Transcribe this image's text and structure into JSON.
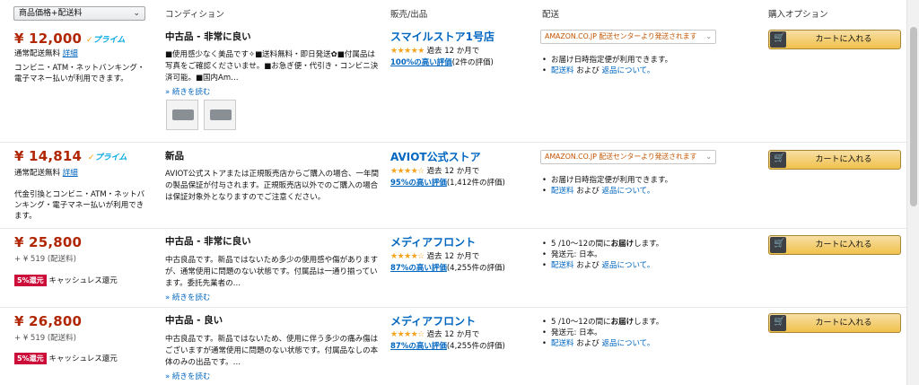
{
  "header": {
    "sort_value": "商品価格+配送料",
    "col_condition": "コンディション",
    "col_seller": "販売/出品",
    "col_shipping": "配送",
    "col_purchase": "購入オプション"
  },
  "offers": [
    {
      "price": "¥ 12,000",
      "prime": "プライム",
      "free_shipping": "通常配送無料",
      "details_link": "詳細",
      "payment": "コンビニ・ATM・ネットバンキング・電子マネー払いが利用できます。",
      "condition": "中古品 - 非常に良い",
      "desc": "■使用感少なく美品です✧■送料無料・即日発送✿■付属品は写真をご確認くださいませ。■お急ぎ便・代引き・コンビニ決済可能。■国内Am…",
      "read_more": "» 続きを読む",
      "seller": "スマイルストア1号店",
      "stars": "★★★★★",
      "period": "過去 12 か月で",
      "positive": "100%の高い評価",
      "count": "(2件の評価)",
      "ship_select": "AMAZON.CO.JP 配送センターより発送されます",
      "ship_1": "お届け日時指定便が利用できます。",
      "ship_fee": "配送料",
      "ship_and": "および",
      "ship_return": "返品について。",
      "cart": "カートに入れる"
    },
    {
      "price": "¥ 14,814",
      "prime": "プライム",
      "free_shipping": "通常配送無料",
      "details_link": "詳細",
      "payment": "代金引換とコンビニ・ATM・ネットバンキング・電子マネー払いが利用できます。",
      "condition": "新品",
      "desc": "AVIOT公式ストアまたは正規販売店からご購入の場合、一年間の製品保証が付与されます。正規販売店以外でのご購入の場合は保証対象外となりますのでご注意ください。",
      "seller": "AVIOT公式ストア",
      "stars": "★★★★☆",
      "period": "過去 12 か月で",
      "positive": "95%の高い評価",
      "count": "(1,412件の評価)",
      "ship_select": "AMAZON.CO.JP 配送センターより発送されます",
      "ship_1": "お届け日時指定便が利用できます。",
      "ship_fee": "配送料",
      "ship_and": "および",
      "ship_return": "返品について。",
      "cart": "カートに入れる"
    },
    {
      "price": "¥ 25,800",
      "shipping_fee": "+ ¥ 519 (配送料)",
      "badge": "5%還元",
      "cashback": "キャッシュレス還元",
      "condition": "中古品 - 非常に良い",
      "desc": "中古良品です。新品ではないため多少の使用感や傷がありますが、通常使用に問題のない状態です。付属品は一通り揃っています。委託先業者の…",
      "read_more": "» 続きを読む",
      "seller": "メディアフロント",
      "stars": "★★★★☆",
      "period": "過去 12 か月で",
      "positive": "87%の高い評価",
      "count": "(4,255件の評価)",
      "ship_1a": "5 /10〜12の間に",
      "ship_1b": "お届け",
      "ship_1c": "します。",
      "ship_2": "発送元: 日本。",
      "ship_fee": "配送料",
      "ship_and": "および",
      "ship_return": "返品について。",
      "cart": "カートに入れる"
    },
    {
      "price": "¥ 26,800",
      "shipping_fee": "+ ¥ 519 (配送料)",
      "badge": "5%還元",
      "cashback": "キャッシュレス還元",
      "condition": "中古品 - 良い",
      "desc": "中古良品です。新品ではないため、使用に伴う多少の痛み傷はございますが通常使用に問題のない状態です。付属品なしの本体のみの出品です。…",
      "read_more": "» 続きを読む",
      "seller": "メディアフロント",
      "stars": "★★★★☆",
      "period": "過去 12 か月で",
      "positive": "87%の高い評価",
      "count": "(4,255件の評価)",
      "ship_1a": "5 /10〜12の間に",
      "ship_1b": "お届け",
      "ship_1c": "します。",
      "ship_2": "発送元: 日本。",
      "ship_fee": "配送料",
      "ship_and": "および",
      "ship_return": "返品について。",
      "cart": "カートに入れる"
    }
  ]
}
